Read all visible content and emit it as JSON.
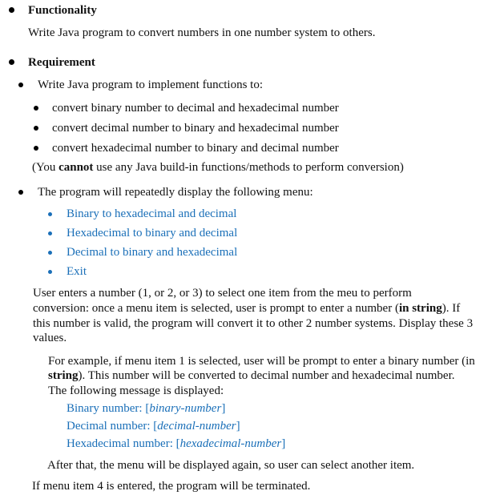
{
  "sections": {
    "functionality": {
      "heading": "Functionality",
      "text": "Write Java program to convert numbers in one number system to others."
    },
    "requirement": {
      "heading": "Requirement",
      "implement": {
        "intro": "Write Java program to implement functions to:",
        "items": [
          "convert binary number to decimal and hexadecimal number",
          "convert decimal number to binary and hexadecimal number",
          "convert hexadecimal number to binary and decimal number"
        ],
        "note_prefix": "(You ",
        "note_bold": "cannot",
        "note_suffix": " use any Java build-in functions/methods to perform conversion)"
      },
      "menu": {
        "intro": "The program will repeatedly display the following menu:",
        "items": [
          "Binary to hexadecimal and decimal",
          "Hexadecimal to binary and decimal",
          "Decimal to binary and hexadecimal",
          "Exit"
        ]
      },
      "user_enters": {
        "line1": "User enters a number (1, or 2, or 3) to select one item from the meu to perform",
        "line2_prefix": "conversion: once a menu item is selected, user is prompt to enter a number (",
        "line2_bold": "in string",
        "line2_suffix": "). If",
        "line3": "this number is valid, the program will convert it to other 2 number systems. Display these 3",
        "line4": "values."
      },
      "example": {
        "line1": "For example, if menu item 1 is selected, user will be prompt to enter a binary number (in",
        "line2_bold": "string",
        "line2_suffix": "). This number will be converted to decimal number and hexadecimal number.",
        "line3": "The following message is displayed:",
        "messages": [
          {
            "label": "Binary number: [",
            "placeholder": "binary-number",
            "close": "]"
          },
          {
            "label": "Decimal number: [",
            "placeholder": "decimal-number",
            "close": "]"
          },
          {
            "label": "Hexadecimal number: [",
            "placeholder": "hexadecimal-number",
            "close": "]"
          }
        ],
        "after": "After that, the menu will be displayed again, so user can select another item."
      },
      "exit_note": "If menu item 4 is entered, the program will be terminated."
    }
  }
}
